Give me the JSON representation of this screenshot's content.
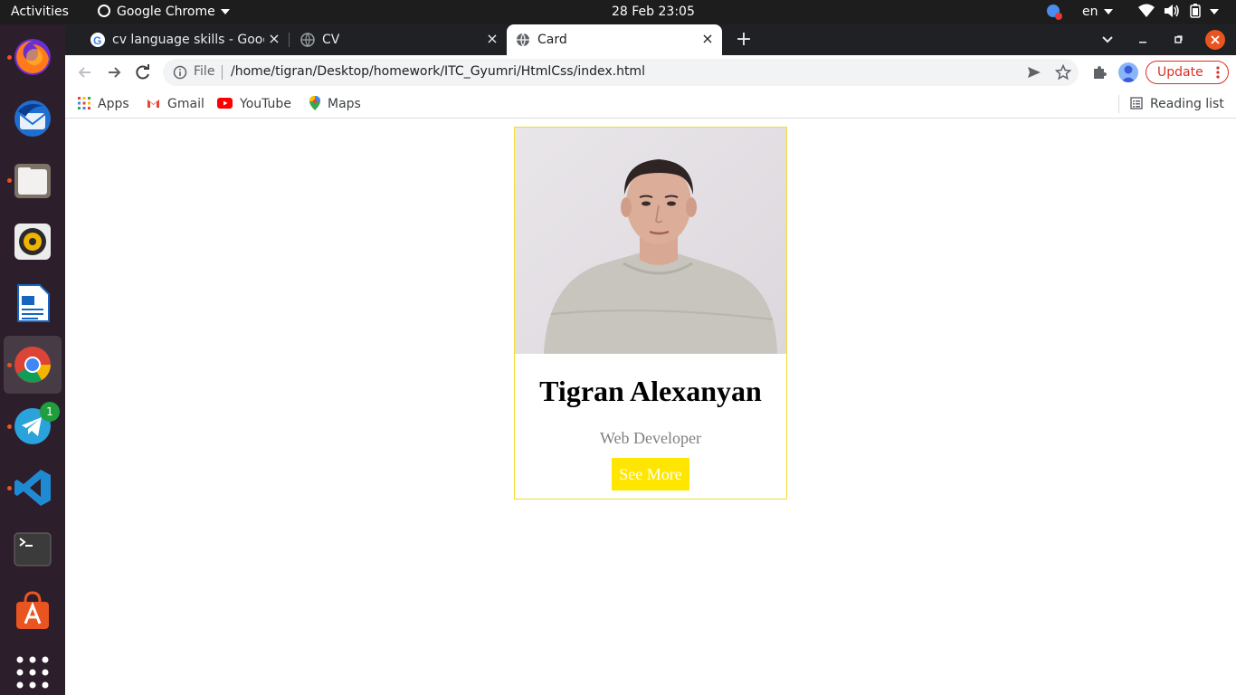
{
  "topbar": {
    "activities": "Activities",
    "app_name": "Google Chrome",
    "clock": "28 Feb  23:05",
    "lang": "en"
  },
  "dock": {
    "telegram_badge": "1"
  },
  "tabs": [
    {
      "title": "cv language skills - Google"
    },
    {
      "title": "CV"
    },
    {
      "title": "Card"
    }
  ],
  "omnibox": {
    "scheme_label": "File",
    "url": "/home/tigran/Desktop/homework/ITC_Gyumri/HtmlCss/index.html"
  },
  "toolbar": {
    "update_label": "Update"
  },
  "bookmarks": {
    "apps": "Apps",
    "gmail": "Gmail",
    "youtube": "YouTube",
    "maps": "Maps",
    "reading_list": "Reading list"
  },
  "card": {
    "name": "Tigran Alexanyan",
    "role": "Web Developer",
    "button": "See More"
  },
  "colors": {
    "card_border": "#f2dc2f",
    "button_bg": "#ffe600",
    "role_text": "#808080",
    "update_red": "#d93025"
  }
}
